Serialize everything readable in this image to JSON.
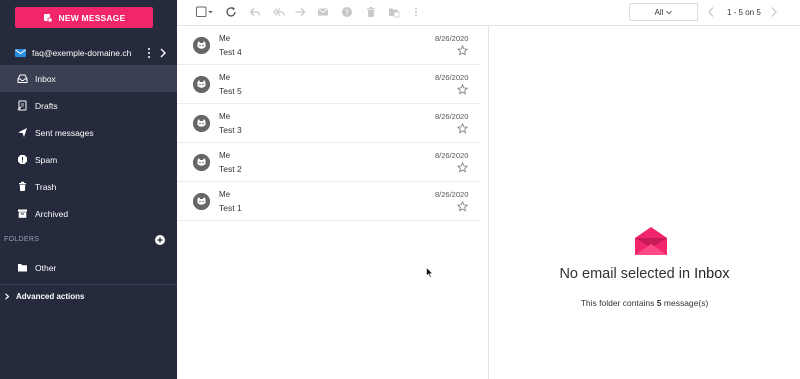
{
  "colors": {
    "accent": "#f0256b",
    "sidebar_bg": "#252a3d",
    "sidebar_active": "#3a3f53",
    "account_icon": "#2a8de0"
  },
  "sidebar": {
    "new_message_label": "NEW MESSAGE",
    "account_email": "faq@exemple-domaine.ch",
    "items": [
      {
        "label": "Inbox",
        "icon": "inbox-icon",
        "active": true
      },
      {
        "label": "Drafts",
        "icon": "drafts-icon",
        "active": false
      },
      {
        "label": "Sent messages",
        "icon": "send-icon",
        "active": false
      },
      {
        "label": "Spam",
        "icon": "spam-icon",
        "active": false
      },
      {
        "label": "Trash",
        "icon": "trash-icon",
        "active": false
      },
      {
        "label": "Archived",
        "icon": "archive-icon",
        "active": false
      }
    ],
    "folders_heading": "FOLDERS",
    "folders": [
      {
        "label": "Other",
        "icon": "folder-icon"
      }
    ],
    "advanced_label": "Advanced actions"
  },
  "toolbar": {
    "filter_label": "All",
    "pagination_text": "1 - 5 on 5"
  },
  "messages": [
    {
      "sender": "Me",
      "subject": "Test 4",
      "date": "8/26/2020"
    },
    {
      "sender": "Me",
      "subject": "Test 5",
      "date": "8/26/2020"
    },
    {
      "sender": "Me",
      "subject": "Test 3",
      "date": "8/26/2020"
    },
    {
      "sender": "Me",
      "subject": "Test 2",
      "date": "8/26/2020"
    },
    {
      "sender": "Me",
      "subject": "Test 1",
      "date": "8/26/2020"
    }
  ],
  "empty_pane": {
    "title_prefix": "No email selected in",
    "folder_name": "Inbox",
    "sub_prefix": "This folder contains",
    "count": "5",
    "sub_suffix": "message(s)"
  }
}
